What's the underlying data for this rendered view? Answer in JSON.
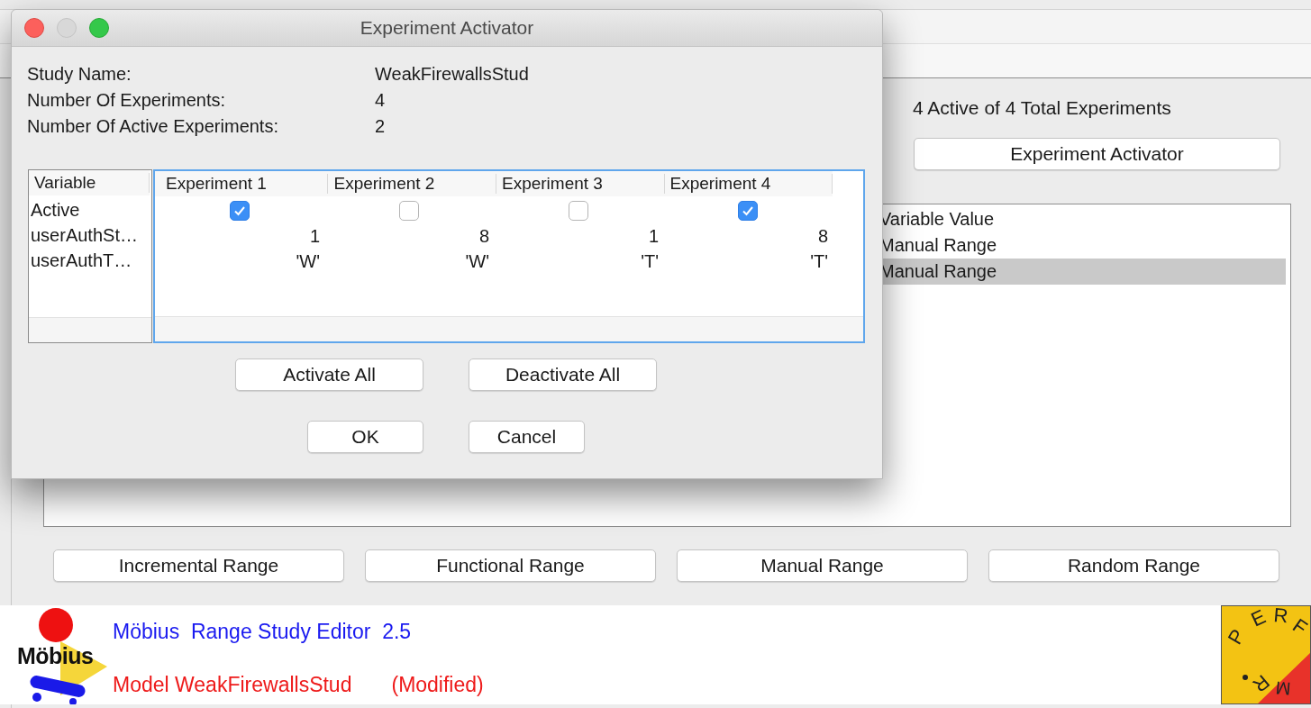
{
  "main_window": {
    "summary": "4 Active of 4 Total Experiments",
    "activator_button": "Experiment Activator",
    "variables_table": {
      "column": "Variable Value",
      "rows": [
        {
          "value": "Manual Range",
          "selected": false
        },
        {
          "value": "Manual Range",
          "selected": true
        }
      ]
    },
    "range_buttons": [
      "Incremental Range",
      "Functional Range",
      "Manual Range",
      "Random Range"
    ],
    "footer": {
      "logo_text": "Möbius",
      "title": "Möbius  Range Study Editor  2.5",
      "model": "Model WeakFirewallsStud",
      "status": "(Modified)",
      "badge_letters": [
        "PERF",
        "RM"
      ]
    }
  },
  "dialog": {
    "title": "Experiment Activator",
    "info": [
      {
        "label": "Study Name:",
        "value": "WeakFirewallsStud"
      },
      {
        "label": "Number Of Experiments:",
        "value": "4"
      },
      {
        "label": "Number Of Active Experiments:",
        "value": "2"
      }
    ],
    "table": {
      "variable_header": "Variable",
      "variable_names": [
        "Active",
        "userAuthSt…",
        "userAuthT…"
      ],
      "experiments": [
        {
          "header": "Experiment 1",
          "active": true,
          "values": [
            "1",
            "'W'"
          ]
        },
        {
          "header": "Experiment 2",
          "active": false,
          "values": [
            "8",
            "'W'"
          ]
        },
        {
          "header": "Experiment 3",
          "active": false,
          "values": [
            "1",
            "'T'"
          ]
        },
        {
          "header": "Experiment 4",
          "active": true,
          "values": [
            "8",
            "'T'"
          ]
        }
      ]
    },
    "bulk_buttons": [
      "Activate All",
      "Deactivate All"
    ],
    "buttons": [
      "OK",
      "Cancel"
    ]
  }
}
